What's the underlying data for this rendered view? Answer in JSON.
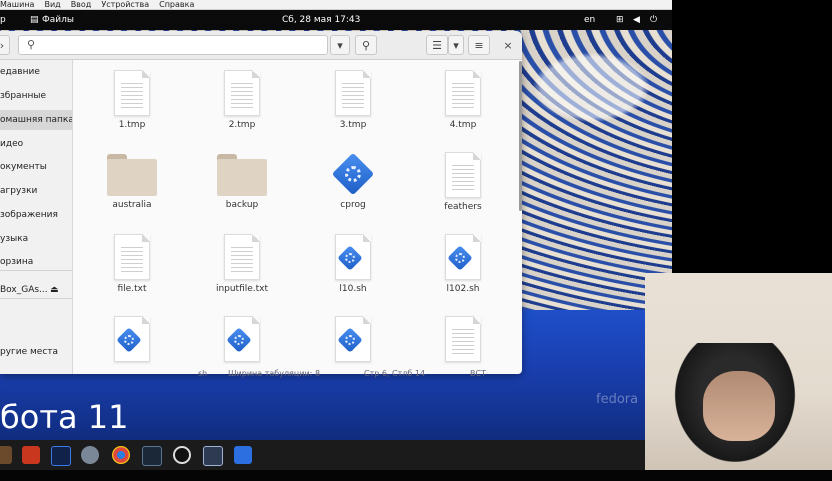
{
  "host_menu": [
    "Машина",
    "Вид",
    "Ввод",
    "Устройства",
    "Справка"
  ],
  "topbar": {
    "left_fragment": "р",
    "app_menu": "Файлы",
    "clock": "Сб, 28 мая  17:43",
    "lang": "en"
  },
  "sidebar": {
    "items": [
      "едавние",
      "збранные",
      "омашняя папка",
      "идео",
      "окументы",
      "агрузки",
      "зображения",
      "узыка",
      "орзина",
      "Box_GAs...",
      "ругие места"
    ],
    "selected_index": 2
  },
  "files": [
    {
      "name": "1.tmp",
      "type": "doc"
    },
    {
      "name": "2.tmp",
      "type": "doc"
    },
    {
      "name": "3.tmp",
      "type": "doc"
    },
    {
      "name": "4.tmp",
      "type": "doc"
    },
    {
      "name": "australia",
      "type": "folder"
    },
    {
      "name": "backup",
      "type": "folder"
    },
    {
      "name": "cprog",
      "type": "exec"
    },
    {
      "name": "feathers",
      "type": "doc"
    },
    {
      "name": "file.txt",
      "type": "doc"
    },
    {
      "name": "inputfile.txt",
      "type": "doc"
    },
    {
      "name": "l10.sh",
      "type": "script"
    },
    {
      "name": "l102.sh",
      "type": "script"
    },
    {
      "name": "",
      "type": "script"
    },
    {
      "name": "",
      "type": "script"
    },
    {
      "name": "",
      "type": "script"
    },
    {
      "name": "",
      "type": "doc"
    }
  ],
  "behind_status": [
    "sh",
    "Ширина табуляции: 8",
    "Стр 6, Стлб 14",
    "ВСТ"
  ],
  "slide_title": "бота 11",
  "wallpaper_brand": "fedora",
  "colors": {
    "accent": "#2b6fe0",
    "topbar": "#0b0b0b",
    "sidebar_selected": "#d7d7d7"
  }
}
